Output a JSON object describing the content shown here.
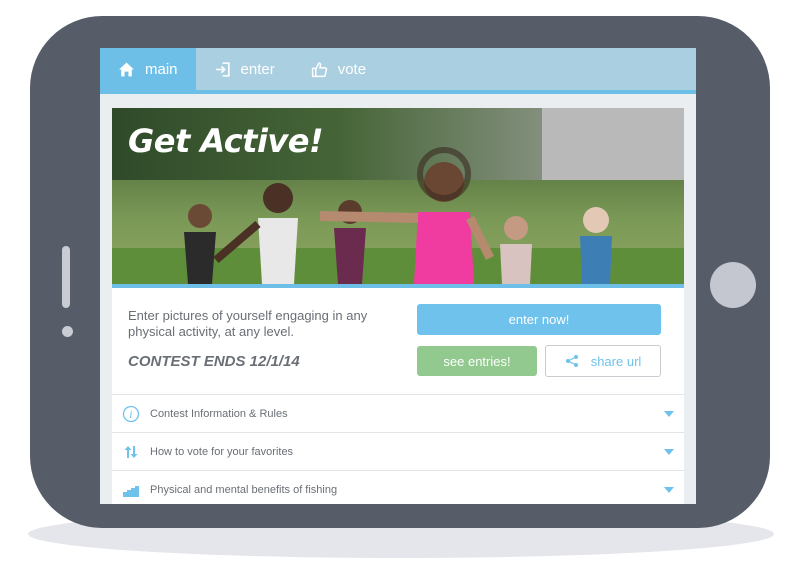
{
  "nav": {
    "tabs": [
      {
        "label": "main",
        "icon": "home-icon",
        "active": true
      },
      {
        "label": "enter",
        "icon": "sign-in-icon",
        "active": false
      },
      {
        "label": "vote",
        "icon": "thumbs-up-icon",
        "active": false
      }
    ]
  },
  "hero": {
    "title": "Get Active!"
  },
  "intro": {
    "description": "Enter pictures of yourself engaging in any physical activity, at any level.",
    "contest_ends": "CONTEST ENDS 12/1/14"
  },
  "buttons": {
    "enter_label": "enter now!",
    "see_label": "see entries!",
    "share_label": "share url"
  },
  "accordion": [
    {
      "label": "Contest Information & Rules",
      "icon": "info-icon"
    },
    {
      "label": "How to vote for your favorites",
      "icon": "sort-arrows-icon"
    },
    {
      "label": "Physical and mental benefits of fishing",
      "icon": "stairs-icon"
    }
  ],
  "colors": {
    "accent": "#6ebfe8",
    "nav_bg": "#a9cfe0",
    "green_button": "#91c98e",
    "device": "#575c69"
  }
}
